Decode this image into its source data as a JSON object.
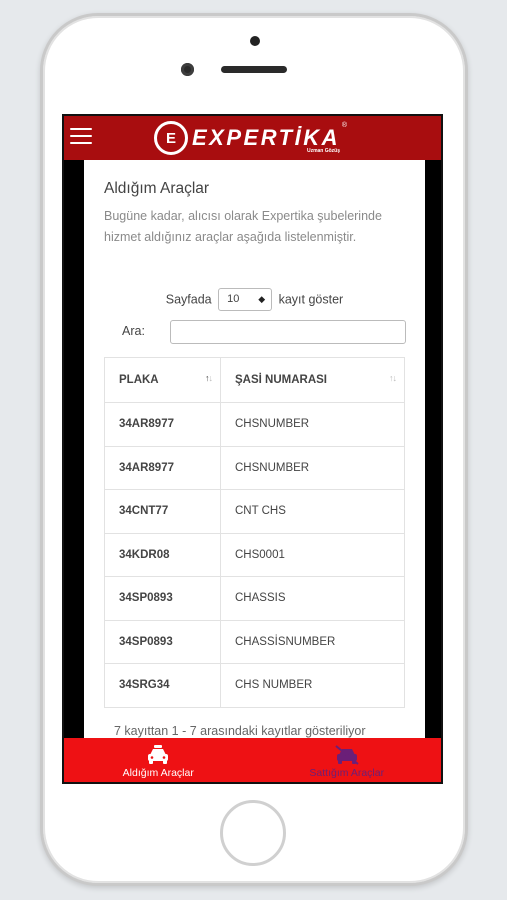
{
  "app": {
    "logo_text": "EXPERTİKA",
    "logo_mark": "E",
    "logo_subtitle": "Uzman Gözüş",
    "logo_reg": "®"
  },
  "page": {
    "title": "Aldığım Araçlar",
    "description": "Bugüne kadar, alıcısı olarak Expertika şubelerinde hizmet aldığınız araçlar aşağıda listelenmiştir."
  },
  "table_controls": {
    "length_prefix": "Sayfada",
    "length_value": "10",
    "length_suffix": "kayıt göster",
    "search_label": "Ara:",
    "search_value": ""
  },
  "table": {
    "columns": [
      "PLAKA",
      "ŞASİ NUMARASI"
    ],
    "rows": [
      [
        "34AR8977",
        "CHSNUMBER"
      ],
      [
        "34AR8977",
        "CHSNUMBER"
      ],
      [
        "34CNT77",
        "CNT CHS"
      ],
      [
        "34KDR08",
        "CHS0001"
      ],
      [
        "34SP0893",
        "CHASSIS"
      ],
      [
        "34SP0893",
        "CHASSİSNUMBER"
      ],
      [
        "34SRG34",
        "CHS NUMBER"
      ]
    ],
    "info": "7 kayıttan 1 - 7 arasındaki kayıtlar gösteriliyor"
  },
  "bottom_nav": {
    "tabs": [
      {
        "label": "Aldığım Araçlar",
        "icon": "car-icon",
        "active": true
      },
      {
        "label": "Sattığım Araçlar",
        "icon": "car-crossed-icon",
        "active": false
      }
    ]
  },
  "colors": {
    "topbar": "#a80d0f",
    "bottom_bar": "#ee1114",
    "inactive_tab": "#6b1f78"
  }
}
